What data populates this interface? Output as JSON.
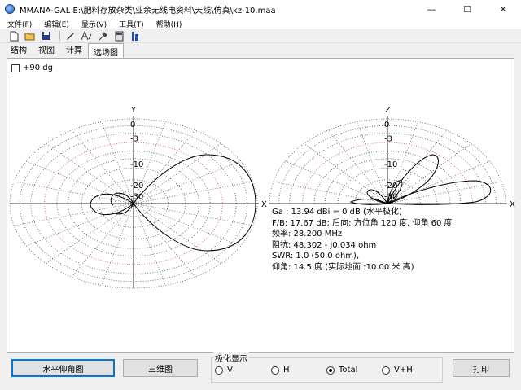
{
  "window": {
    "title": "MMANA-GAL E:\\肥料存放杂类\\业余无线电资料\\天线\\仿真\\kz-10.maa",
    "minimize": "—",
    "maximize": "☐",
    "close": "✕"
  },
  "menu": [
    "文件(F)",
    "编辑(E)",
    "显示(V)",
    "工具(T)",
    "帮助(H)"
  ],
  "tabs": [
    "结构",
    "视图",
    "计算",
    "远场图"
  ],
  "active_tab": "远场图",
  "checkbox": {
    "label": "+90 dg",
    "checked": false
  },
  "plot_left": {
    "axis_v": "Y",
    "axis_h": "X",
    "rings": [
      "0",
      "-3",
      "-10",
      "-20",
      "-30"
    ]
  },
  "plot_right": {
    "axis_v": "Z",
    "axis_h": "X",
    "rings": [
      "0",
      "-3",
      "-10",
      "-20",
      "-30"
    ]
  },
  "info_lines": [
    "Ga : 13.94 dBi = 0 dB  (水平极化)",
    "F/B: 17.67 dB; 后向: 方位角 120 度, 仰角 60 度",
    "频率: 28.200 MHz",
    "阻抗: 48.302 - j0.034 ohm",
    "SWR: 1.0 (50.0 ohm),",
    "仰角: 14.5 度 (实际地面  :10.00 米 高)"
  ],
  "buttons": {
    "horizontal_elevation": "水平仰角图",
    "three_d": "三维图",
    "print": "打印"
  },
  "polarization": {
    "title": "极化显示",
    "options": [
      "V",
      "H",
      "Total",
      "V+H"
    ],
    "selected": "Total"
  },
  "colors": {
    "grid": "#555555",
    "red_ring": "#e05050",
    "pattern": "#000000",
    "accent": "#0078d7"
  }
}
